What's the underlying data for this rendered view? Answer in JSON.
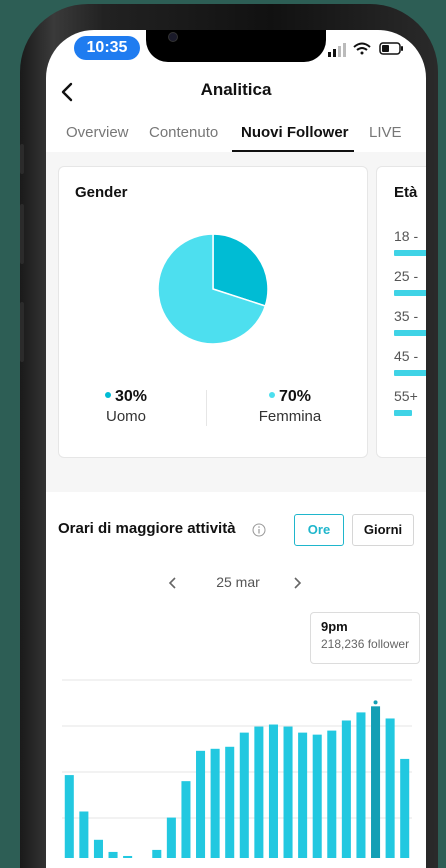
{
  "status": {
    "time": "10:35"
  },
  "nav": {
    "title": "Analitica"
  },
  "tabs": [
    {
      "label": "Overview",
      "active": false
    },
    {
      "label": "Contenuto",
      "active": false
    },
    {
      "label": "Nuovi Follower",
      "active": true
    },
    {
      "label": "LIVE",
      "active": false
    }
  ],
  "gender": {
    "title": "Gender",
    "male": {
      "pct": "30%",
      "label": "Uomo",
      "value": 30,
      "color": "#00bcd4"
    },
    "female": {
      "pct": "70%",
      "label": "Femmina",
      "value": 70,
      "color": "#4ddfef"
    }
  },
  "age": {
    "title": "Età",
    "rows": [
      {
        "label": "18 -",
        "fill": 0.9
      },
      {
        "label": "25 -",
        "fill": 0.9
      },
      {
        "label": "35 -",
        "fill": 0.9
      },
      {
        "label": "45 -",
        "fill": 0.9
      },
      {
        "label": "55+",
        "fill": 0.45
      }
    ],
    "color": "#3fd3e6"
  },
  "activity": {
    "title": "Orari di maggiore attività",
    "hours_button": "Ore",
    "days_button": "Giorni",
    "date": "25 mar",
    "prev_icon": "chevron-left-icon",
    "next_icon": "chevron-right-icon",
    "tooltip": {
      "time": "9pm",
      "value": "218,236 follower"
    }
  },
  "colors": {
    "accent": "#1fb6cc",
    "bar": "#22c8e0",
    "bar_highlight": "#139fb5"
  },
  "chart_data": {
    "type": "bar",
    "x": [
      0,
      1,
      2,
      3,
      4,
      5,
      6,
      7,
      8,
      9,
      10,
      11,
      12,
      13,
      14,
      15,
      16,
      17,
      18,
      19,
      20,
      21,
      22,
      23
    ],
    "values": [
      82,
      46,
      18,
      6,
      2,
      0,
      8,
      40,
      76,
      106,
      108,
      110,
      124,
      130,
      132,
      130,
      124,
      122,
      126,
      136,
      144,
      150,
      138,
      98
    ],
    "highlight_index": 21,
    "ylim": [
      0,
      180
    ],
    "grid": true
  }
}
